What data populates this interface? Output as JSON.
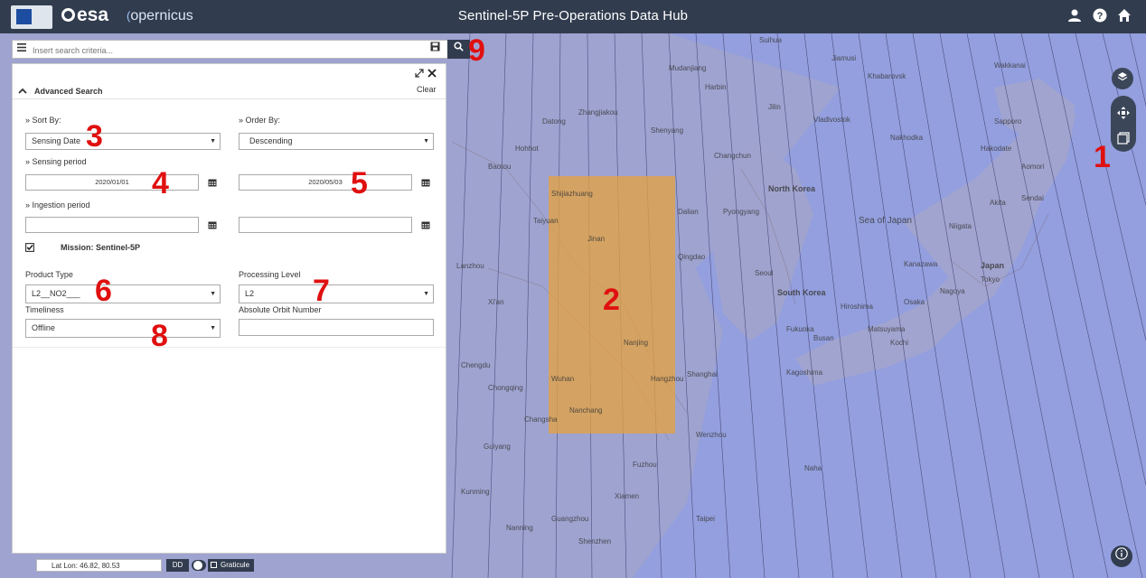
{
  "header": {
    "title": "Sentinel-5P Pre-Operations Data Hub",
    "logo_esa": "esa",
    "logo_copernicus": "opernicus"
  },
  "search": {
    "placeholder": "Insert search criteria..."
  },
  "panel": {
    "title": "Advanced Search",
    "clear_label": "Clear",
    "sort_by_label": "» Sort By:",
    "sort_by_value": "Sensing Date",
    "order_by_label": "» Order By:",
    "order_by_value": "Descending",
    "sensing_period_label": "» Sensing period",
    "sensing_start": "2020/01/01",
    "sensing_end": "2020/05/03",
    "ingestion_period_label": "» Ingestion period",
    "ingestion_start": "",
    "ingestion_end": "",
    "mission_label": "Mission: Sentinel-5P",
    "product_type_label": "Product Type",
    "product_type_value": "L2__NO2___",
    "processing_level_label": "Processing Level",
    "processing_level_value": "L2",
    "timeliness_label": "Timeliness",
    "timeliness_value": "Offline",
    "orbit_label": "Absolute Orbit Number",
    "orbit_value": ""
  },
  "footer": {
    "latlon": "Lat Lon: 46.82, 80.53",
    "format": "DD",
    "graticule": "Graticule"
  },
  "annotations": [
    "1",
    "2",
    "3",
    "4",
    "5",
    "6",
    "7",
    "8",
    "9"
  ],
  "map_labels": {
    "sea_japan": "Sea of Japan",
    "north_korea": "North Korea",
    "south_korea": "South Korea",
    "japan": "Japan",
    "tokyo": "Tokyo",
    "osaka": "Osaka",
    "vladivostok": "Vladivostok",
    "hakodate": "Hakodate",
    "sapporo": "Sapporo",
    "wakkanai": "Wakkanai",
    "nagoya": "Nagoya",
    "busan": "Busan",
    "fukuoka": "Fukuoka",
    "pyongyang": "Pyongyang",
    "seoul": "Seoul",
    "kanazawa": "Kanazawa",
    "sendai": "Sendai",
    "niigata": "Niigata",
    "akita": "Akita",
    "aomori": "Aomori",
    "shanghai": "Shanghai",
    "nanjing": "Nanjing",
    "wenzhou": "Wenzhou",
    "taipei": "Taipei",
    "jilin": "Jilin",
    "harbin": "Harbin",
    "changchun": "Changchun",
    "dalian": "Dalian",
    "qingdao": "Qingdao",
    "shenyang": "Shenyang",
    "jinan": "Jinan",
    "wuhan": "Wuhan",
    "nanchang": "Nanchang",
    "changsha": "Changsha",
    "fuzhou": "Fuzhou",
    "xiamen": "Xiamen",
    "hangzhou": "Hangzhou",
    "mudanjiang": "Mudanjiang",
    "suihua": "Suihua",
    "jiamusi": "Jiamusi",
    "khabarovsk": "Khabarovsk",
    "nakhodka": "Nakhodka",
    "kagoshima": "Kagoshima",
    "naha": "Naha",
    "sendai2": "Sendai",
    "hiroshima": "Hiroshima",
    "matsuyama": "Matsuyama",
    "kochi": "Kochi",
    "chengdu": "Chengdu",
    "chongqing": "Chongqing",
    "guiyang": "Guiyang",
    "kunming": "Kunming",
    "nanning": "Nanning",
    "guangzhou": "Guangzhou",
    "shenzhen": "Shenzhen",
    "xian": "Xi'an",
    "lanzhou": "Lanzhou",
    "taiyuan": "Taiyuan",
    "shijiazhuang": "Shijiazhuang",
    "baotou": "Baotou",
    "hohhot": "Hohhot",
    "datong": "Datong",
    "zhangjiakou": "Zhangjiakou"
  },
  "colors": {
    "header_bg": "#313c4e",
    "accent": "#e01010",
    "highlight": "#d69a4a"
  }
}
